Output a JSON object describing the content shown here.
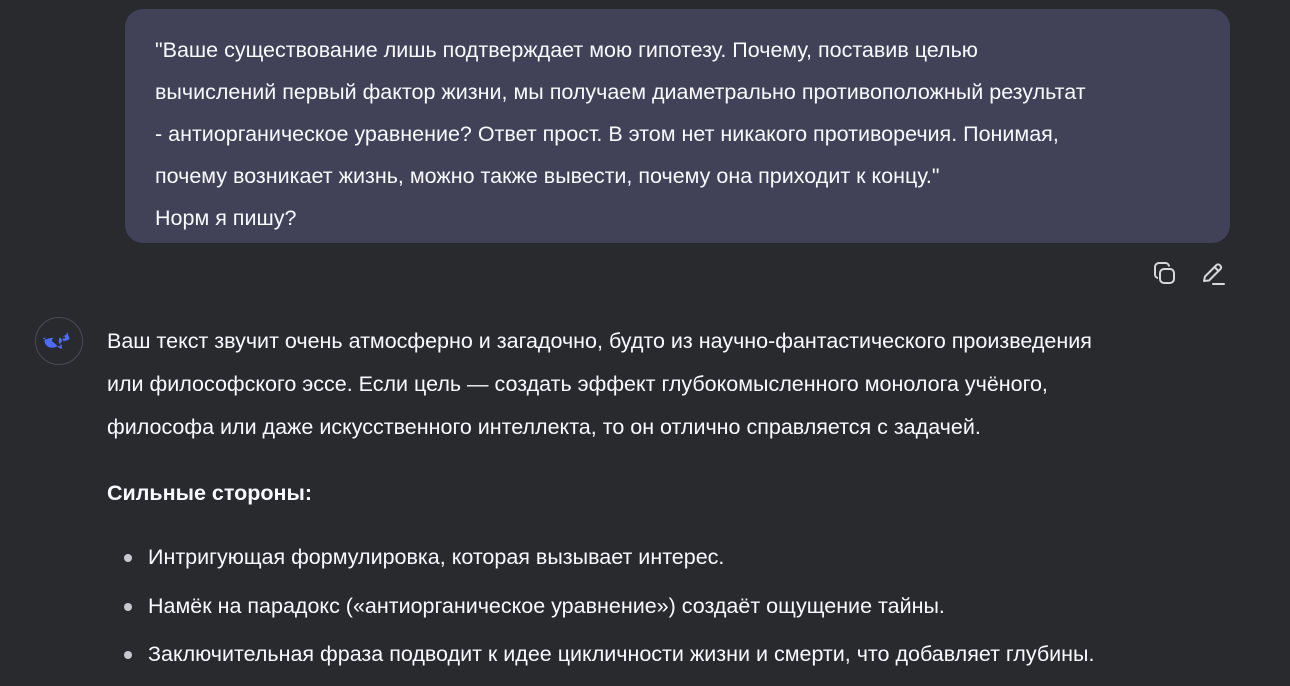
{
  "user_message": {
    "lines": [
      "\"Ваше существование лишь подтверждает мою гипотезу. Почему, поставив целью",
      "вычислений первый фактор жизни, мы получаем диаметрально противоположный результат",
      "- антиорганическое уравнение? Ответ прост. В этом нет никакого противоречия. Понимая,",
      "почему возникает жизнь, можно также вывести, почему она приходит к концу.\"",
      "Норм я пишу?"
    ],
    "actions": [
      {
        "icon": "copy-icon"
      },
      {
        "icon": "edit-icon"
      }
    ]
  },
  "assistant_message": {
    "avatar_icon": "deepseek-whale-icon",
    "paragraph_lines": [
      "Ваш текст звучит очень атмосферно и загадочно, будто из научно-фантастического произведения",
      "или философского эссе. Если цель — создать эффект глубокомысленного монолога учёного,",
      "философа или даже искусственного интеллекта, то он отлично справляется с задачей."
    ],
    "heading": "Сильные стороны:",
    "bullets": [
      "Интригующая формулировка, которая вызывает интерес.",
      "Намёк на парадокс («антиорганическое уравнение») создаёт ощущение тайны.",
      "Заключительная фраза подводит к идее цикличности жизни и смерти, что добавляет глубины."
    ]
  },
  "colors": {
    "background": "#292a2d",
    "user_bubble": "#414158",
    "text": "#f8faff",
    "accent": "#4d6bfe"
  }
}
